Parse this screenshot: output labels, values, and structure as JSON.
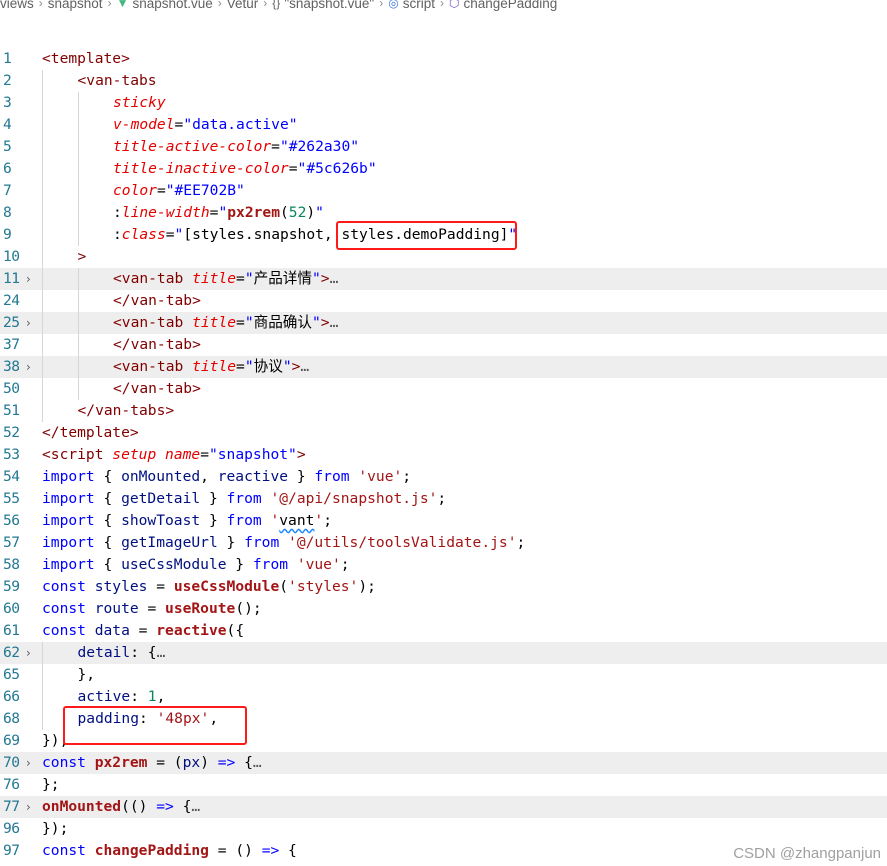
{
  "breadcrumb": [
    {
      "label": "views",
      "icon": ""
    },
    {
      "label": "snapshot",
      "icon": ""
    },
    {
      "label": "snapshot.vue",
      "icon": "vue-icon"
    },
    {
      "label": "Vetur",
      "icon": ""
    },
    {
      "label": "\"snapshot.vue\"",
      "icon": "braces-icon"
    },
    {
      "label": "script",
      "icon": "script-icon"
    },
    {
      "label": "changePadding",
      "icon": "method-icon"
    }
  ],
  "watermark": "CSDN @zhangpanjun",
  "lines": [
    {
      "n": "1",
      "fold": false,
      "indent": 0,
      "tokens": [
        [
          "tagp",
          "<template>"
        ]
      ]
    },
    {
      "n": "2",
      "fold": false,
      "indent": 1,
      "tokens": [
        [
          "tagp",
          "<van-tabs"
        ]
      ]
    },
    {
      "n": "3",
      "fold": false,
      "indent": 2,
      "tokens": [
        [
          "attr",
          "sticky"
        ]
      ]
    },
    {
      "n": "4",
      "fold": false,
      "indent": 2,
      "tokens": [
        [
          "attr",
          "v-model"
        ],
        [
          "plain",
          "="
        ],
        [
          "str",
          "\"data.active\""
        ]
      ]
    },
    {
      "n": "5",
      "fold": false,
      "indent": 2,
      "tokens": [
        [
          "attr",
          "title-active-color"
        ],
        [
          "plain",
          "="
        ],
        [
          "str",
          "\"#262a30\""
        ]
      ]
    },
    {
      "n": "6",
      "fold": false,
      "indent": 2,
      "tokens": [
        [
          "attr",
          "title-inactive-color"
        ],
        [
          "plain",
          "="
        ],
        [
          "str",
          "\"#5c626b\""
        ]
      ]
    },
    {
      "n": "7",
      "fold": false,
      "indent": 2,
      "tokens": [
        [
          "attr",
          "color"
        ],
        [
          "plain",
          "="
        ],
        [
          "str",
          "\"#EE702B\""
        ]
      ]
    },
    {
      "n": "8",
      "fold": false,
      "indent": 2,
      "tokens": [
        [
          "plain",
          ":"
        ],
        [
          "attr",
          "line-width"
        ],
        [
          "plain",
          "="
        ],
        [
          "str",
          "\""
        ],
        [
          "fnb",
          "px2rem"
        ],
        [
          "plain",
          "("
        ],
        [
          "num",
          "52"
        ],
        [
          "plain",
          ")"
        ],
        [
          "str",
          "\""
        ]
      ]
    },
    {
      "n": "9",
      "fold": false,
      "indent": 2,
      "tokens": [
        [
          "plain",
          ":"
        ],
        [
          "attr",
          "class"
        ],
        [
          "plain",
          "="
        ],
        [
          "str",
          "\""
        ],
        [
          "plain",
          "[styles.snapshot, styles.demoPadding]"
        ],
        [
          "str",
          "\""
        ]
      ]
    },
    {
      "n": "10",
      "fold": false,
      "indent": 1,
      "tokens": [
        [
          "punc",
          ">"
        ]
      ]
    },
    {
      "n": "11",
      "fold": true,
      "indent": 2,
      "tokens": [
        [
          "tagp",
          "<van-tab "
        ],
        [
          "attr",
          "title"
        ],
        [
          "plain",
          "="
        ],
        [
          "str",
          "\""
        ],
        [
          "cjk",
          "产品详情"
        ],
        [
          "str",
          "\""
        ],
        [
          "tagp",
          ">"
        ],
        [
          "ell",
          "…"
        ]
      ]
    },
    {
      "n": "24",
      "fold": false,
      "indent": 2,
      "tokens": [
        [
          "tagp",
          "</van-tab>"
        ]
      ]
    },
    {
      "n": "25",
      "fold": true,
      "indent": 2,
      "tokens": [
        [
          "tagp",
          "<van-tab "
        ],
        [
          "attr",
          "title"
        ],
        [
          "plain",
          "="
        ],
        [
          "str",
          "\""
        ],
        [
          "cjk",
          "商品确认"
        ],
        [
          "str",
          "\""
        ],
        [
          "tagp",
          ">"
        ],
        [
          "ell",
          "…"
        ]
      ]
    },
    {
      "n": "37",
      "fold": false,
      "indent": 2,
      "tokens": [
        [
          "tagp",
          "</van-tab>"
        ]
      ]
    },
    {
      "n": "38",
      "fold": true,
      "indent": 2,
      "tokens": [
        [
          "tagp",
          "<van-tab "
        ],
        [
          "attr",
          "title"
        ],
        [
          "plain",
          "="
        ],
        [
          "str",
          "\""
        ],
        [
          "cjk",
          "协议"
        ],
        [
          "str",
          "\""
        ],
        [
          "tagp",
          ">"
        ],
        [
          "ell",
          "…"
        ]
      ]
    },
    {
      "n": "50",
      "fold": false,
      "indent": 2,
      "tokens": [
        [
          "tagp",
          "</van-tab>"
        ]
      ]
    },
    {
      "n": "51",
      "fold": false,
      "indent": 1,
      "tokens": [
        [
          "tagp",
          "</van-tabs>"
        ]
      ]
    },
    {
      "n": "52",
      "fold": false,
      "indent": 0,
      "tokens": [
        [
          "tagp",
          "</template>"
        ]
      ]
    },
    {
      "n": "53",
      "fold": false,
      "indent": 0,
      "tokens": [
        [
          "tagp",
          "<script "
        ],
        [
          "attr",
          "setup"
        ],
        [
          "plain",
          " "
        ],
        [
          "attr",
          "name"
        ],
        [
          "plain",
          "="
        ],
        [
          "str",
          "\"snapshot\""
        ],
        [
          "tagp",
          ">"
        ]
      ]
    },
    {
      "n": "54",
      "fold": false,
      "indent": 0,
      "tokens": [
        [
          "kw",
          "import"
        ],
        [
          "plain",
          " { "
        ],
        [
          "var",
          "onMounted"
        ],
        [
          "plain",
          ", "
        ],
        [
          "var",
          "reactive"
        ],
        [
          "plain",
          " } "
        ],
        [
          "kw",
          "from"
        ],
        [
          "plain",
          " "
        ],
        [
          "strg",
          "'vue'"
        ],
        [
          "plain",
          ";"
        ]
      ]
    },
    {
      "n": "55",
      "fold": false,
      "indent": 0,
      "tokens": [
        [
          "kw",
          "import"
        ],
        [
          "plain",
          " { "
        ],
        [
          "var",
          "getDetail"
        ],
        [
          "plain",
          " } "
        ],
        [
          "kw",
          "from"
        ],
        [
          "plain",
          " "
        ],
        [
          "strg",
          "'@/api/snapshot.js'"
        ],
        [
          "plain",
          ";"
        ]
      ]
    },
    {
      "n": "56",
      "fold": false,
      "indent": 0,
      "tokens": [
        [
          "kw",
          "import"
        ],
        [
          "plain",
          " { "
        ],
        [
          "var",
          "showToast"
        ],
        [
          "plain",
          " } "
        ],
        [
          "kw",
          "from"
        ],
        [
          "plain",
          " "
        ],
        [
          "strg",
          "'"
        ],
        [
          "squig",
          "vant"
        ],
        [
          "strg",
          "'"
        ],
        [
          "plain",
          ";"
        ]
      ]
    },
    {
      "n": "57",
      "fold": false,
      "indent": 0,
      "tokens": [
        [
          "kw",
          "import"
        ],
        [
          "plain",
          " { "
        ],
        [
          "var",
          "getImageUrl"
        ],
        [
          "plain",
          " } "
        ],
        [
          "kw",
          "from"
        ],
        [
          "plain",
          " "
        ],
        [
          "strg",
          "'@/utils/toolsValidate.js'"
        ],
        [
          "plain",
          ";"
        ]
      ]
    },
    {
      "n": "58",
      "fold": false,
      "indent": 0,
      "tokens": [
        [
          "kw",
          "import"
        ],
        [
          "plain",
          " { "
        ],
        [
          "var",
          "useCssModule"
        ],
        [
          "plain",
          " } "
        ],
        [
          "kw",
          "from"
        ],
        [
          "plain",
          " "
        ],
        [
          "strg",
          "'vue'"
        ],
        [
          "plain",
          ";"
        ]
      ]
    },
    {
      "n": "59",
      "fold": false,
      "indent": 0,
      "tokens": [
        [
          "kw",
          "const"
        ],
        [
          "plain",
          " "
        ],
        [
          "var",
          "styles"
        ],
        [
          "plain",
          " = "
        ],
        [
          "fnb",
          "useCssModule"
        ],
        [
          "plain",
          "("
        ],
        [
          "strg",
          "'styles'"
        ],
        [
          "plain",
          ");"
        ]
      ]
    },
    {
      "n": "60",
      "fold": false,
      "indent": 0,
      "tokens": [
        [
          "kw",
          "const"
        ],
        [
          "plain",
          " "
        ],
        [
          "var",
          "route"
        ],
        [
          "plain",
          " = "
        ],
        [
          "fnb",
          "useRoute"
        ],
        [
          "plain",
          "();"
        ]
      ]
    },
    {
      "n": "61",
      "fold": false,
      "indent": 0,
      "tokens": [
        [
          "kw",
          "const"
        ],
        [
          "plain",
          " "
        ],
        [
          "var",
          "data"
        ],
        [
          "plain",
          " = "
        ],
        [
          "fnb",
          "reactive"
        ],
        [
          "plain",
          "({"
        ]
      ]
    },
    {
      "n": "62",
      "fold": true,
      "indent": 1,
      "tokens": [
        [
          "var",
          "detail"
        ],
        [
          "plain",
          ": {"
        ],
        [
          "ell",
          "…"
        ]
      ]
    },
    {
      "n": "65",
      "fold": false,
      "indent": 1,
      "tokens": [
        [
          "plain",
          "},"
        ]
      ]
    },
    {
      "n": "66",
      "fold": false,
      "indent": 1,
      "tokens": [
        [
          "var",
          "active"
        ],
        [
          "plain",
          ": "
        ],
        [
          "num",
          "1"
        ],
        [
          "plain",
          ","
        ]
      ]
    },
    {
      "n": "68",
      "fold": false,
      "indent": 1,
      "tokens": [
        [
          "var",
          "padding"
        ],
        [
          "plain",
          ": "
        ],
        [
          "strg",
          "'48px'"
        ],
        [
          "plain",
          ","
        ]
      ]
    },
    {
      "n": "69",
      "fold": false,
      "indent": 0,
      "tokens": [
        [
          "plain",
          "});"
        ]
      ]
    },
    {
      "n": "70",
      "fold": true,
      "indent": 0,
      "tokens": [
        [
          "kw",
          "const"
        ],
        [
          "plain",
          " "
        ],
        [
          "fnb",
          "px2rem"
        ],
        [
          "plain",
          " = ("
        ],
        [
          "var",
          "px"
        ],
        [
          "plain",
          ") "
        ],
        [
          "kw",
          "=>"
        ],
        [
          "plain",
          " {"
        ],
        [
          "ell",
          "…"
        ]
      ]
    },
    {
      "n": "76",
      "fold": false,
      "indent": 0,
      "tokens": [
        [
          "plain",
          "};"
        ]
      ]
    },
    {
      "n": "77",
      "fold": true,
      "indent": 0,
      "tokens": [
        [
          "fnb",
          "onMounted"
        ],
        [
          "plain",
          "(() "
        ],
        [
          "kw",
          "=>"
        ],
        [
          "plain",
          " {"
        ],
        [
          "ell",
          "…"
        ]
      ]
    },
    {
      "n": "96",
      "fold": false,
      "indent": 0,
      "tokens": [
        [
          "plain",
          "});"
        ]
      ]
    },
    {
      "n": "97",
      "fold": false,
      "indent": 0,
      "tokens": [
        [
          "kw",
          "const"
        ],
        [
          "plain",
          " "
        ],
        [
          "fnb",
          "changePadding"
        ],
        [
          "plain",
          " = () "
        ],
        [
          "kw",
          "=>"
        ],
        [
          "plain",
          " {"
        ]
      ]
    }
  ]
}
